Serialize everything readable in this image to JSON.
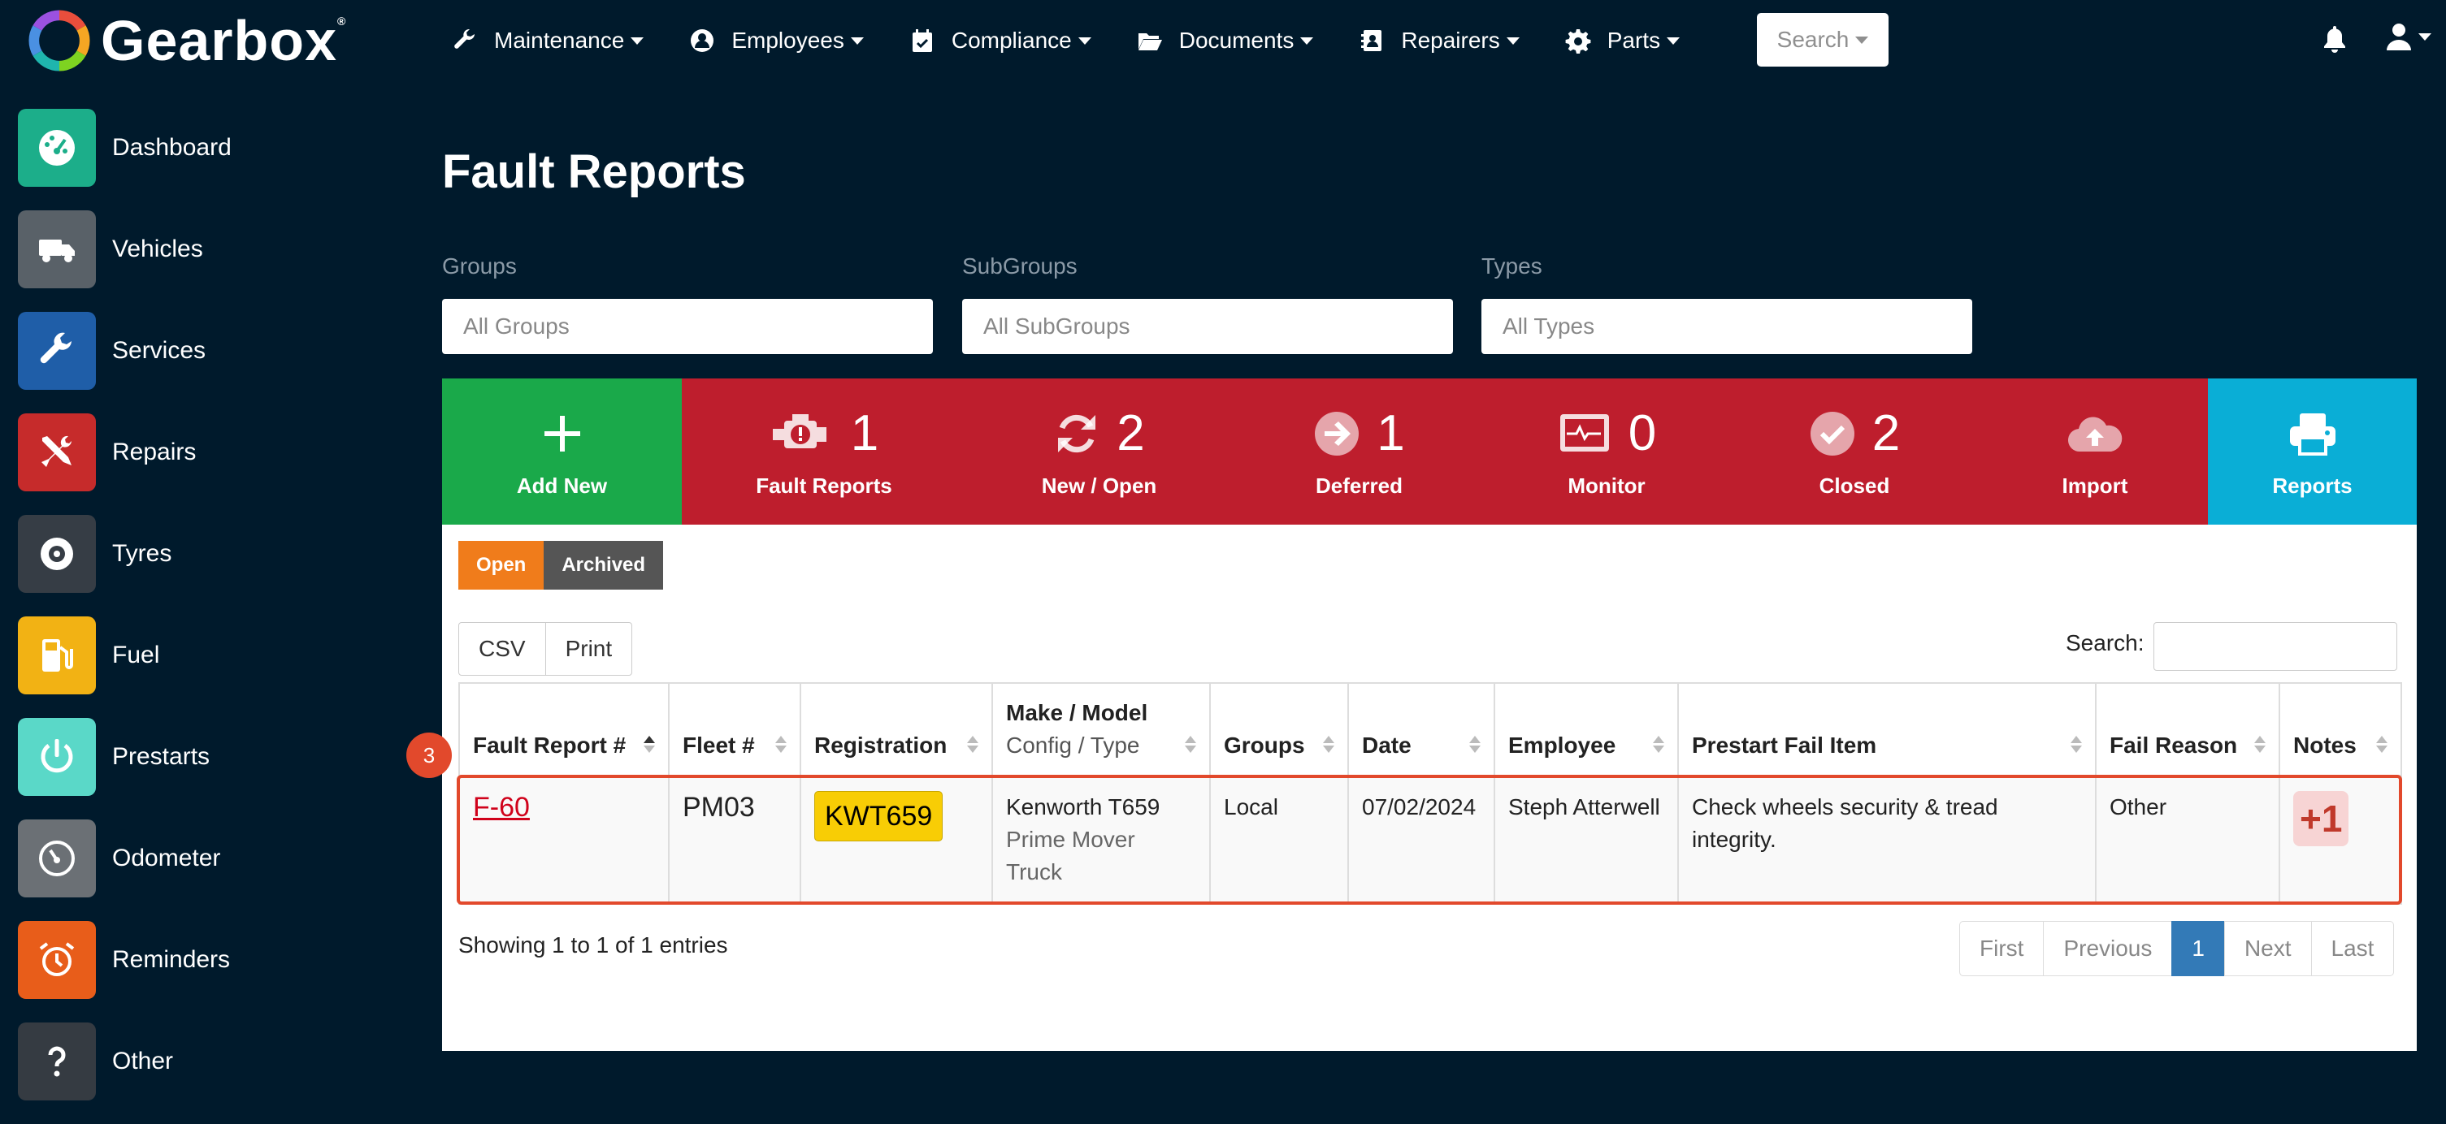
{
  "brand": {
    "name": "Gearbox",
    "mark": "®"
  },
  "nav": [
    {
      "icon": "wrench-icon",
      "label": "Maintenance"
    },
    {
      "icon": "user-circle-icon",
      "label": "Employees"
    },
    {
      "icon": "calendar-check-icon",
      "label": "Compliance"
    },
    {
      "icon": "folder-open-icon",
      "label": "Documents"
    },
    {
      "icon": "address-book-icon",
      "label": "Repairers"
    },
    {
      "icon": "gear-icon",
      "label": "Parts"
    }
  ],
  "header": {
    "search_label": "Search"
  },
  "sidebar": [
    {
      "label": "Dashboard",
      "icon": "gauge-icon",
      "color": "#1cae8a"
    },
    {
      "label": "Vehicles",
      "icon": "truck-icon",
      "color": "#596168"
    },
    {
      "label": "Services",
      "icon": "wrench-icon",
      "color": "#1f5ea8"
    },
    {
      "label": "Repairs",
      "icon": "tools-icon",
      "color": "#c62b2b"
    },
    {
      "label": "Tyres",
      "icon": "tyre-icon",
      "color": "#363d45"
    },
    {
      "label": "Fuel",
      "icon": "fuel-pump-icon",
      "color": "#f2b214"
    },
    {
      "label": "Prestarts",
      "icon": "power-icon",
      "color": "#5ad8c8"
    },
    {
      "label": "Odometer",
      "icon": "odometer-icon",
      "color": "#6b7075"
    },
    {
      "label": "Reminders",
      "icon": "alarm-clock-icon",
      "color": "#e85d1a"
    },
    {
      "label": "Other",
      "icon": "question-icon",
      "color": "#353b42"
    }
  ],
  "page": {
    "title": "Fault Reports"
  },
  "filters": {
    "groups": {
      "label": "Groups",
      "placeholder": "All Groups"
    },
    "subgroups": {
      "label": "SubGroups",
      "placeholder": "All SubGroups"
    },
    "types": {
      "label": "Types",
      "placeholder": "All Types"
    }
  },
  "stats": {
    "add_new": {
      "label": "Add New",
      "color": "#1aa94a"
    },
    "fault_reports": {
      "label": "Fault Reports",
      "count": "1"
    },
    "new_open": {
      "label": "New / Open",
      "count": "2"
    },
    "deferred": {
      "label": "Deferred",
      "count": "1"
    },
    "monitor": {
      "label": "Monitor",
      "count": "0"
    },
    "closed": {
      "label": "Closed",
      "count": "2"
    },
    "import": {
      "label": "Import"
    },
    "reports": {
      "label": "Reports",
      "color": "#0aaed6"
    },
    "red_color": "#be1e2d"
  },
  "tabs": {
    "open": "Open",
    "archived": "Archived",
    "open_color": "#f07c1b",
    "archived_color": "#555555"
  },
  "toolbar": {
    "csv": "CSV",
    "print": "Print",
    "search_label": "Search:"
  },
  "table": {
    "headers": {
      "fault_report": "Fault Report #",
      "fleet": "Fleet #",
      "registration": "Registration",
      "make_model": "Make / Model",
      "config_type": "Config / Type",
      "groups": "Groups",
      "date": "Date",
      "employee": "Employee",
      "fail_item": "Prestart Fail Item",
      "fail_reason": "Fail Reason",
      "notes": "Notes"
    },
    "rows": [
      {
        "fault_report": "F-60",
        "fleet": "PM03",
        "registration": "KWT659",
        "make_model": "Kenworth T659",
        "config_type": "Prime Mover Truck",
        "groups": "Local",
        "date": "07/02/2024",
        "employee": "Steph Atterwell",
        "fail_item": "Check wheels security & tread integrity.",
        "fail_reason": "Other",
        "notes": "+1"
      }
    ]
  },
  "row_marker": "3",
  "footer": {
    "entries": "Showing 1 to 1 of 1 entries",
    "pager": {
      "first": "First",
      "previous": "Previous",
      "current": "1",
      "next": "Next",
      "last": "Last"
    }
  }
}
